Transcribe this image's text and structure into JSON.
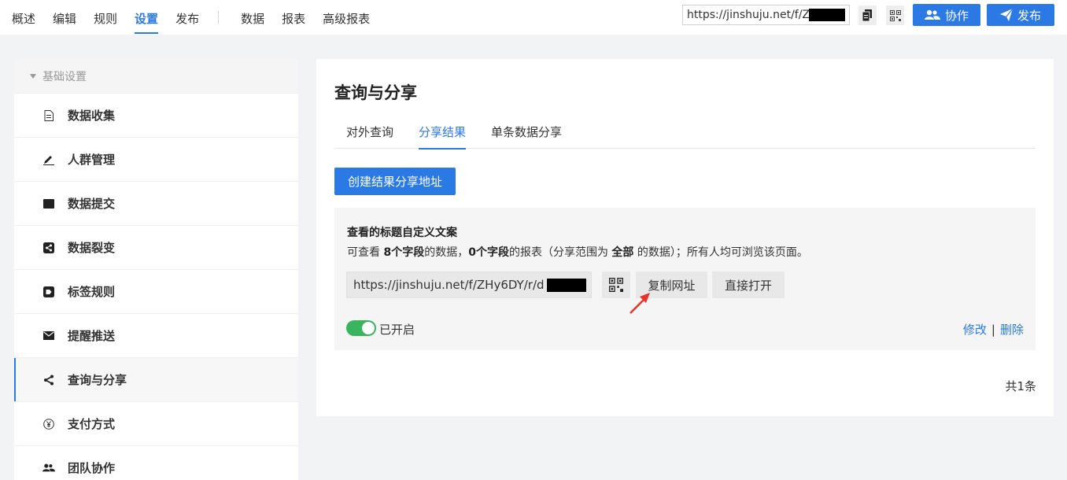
{
  "nav": {
    "items": [
      "概述",
      "编辑",
      "规则",
      "设置",
      "发布"
    ],
    "items2": [
      "数据",
      "报表",
      "高级报表"
    ],
    "active": "设置"
  },
  "header": {
    "url": "https://jinshuju.net/f/Z",
    "collab_label": "协作",
    "publish_label": "发布",
    "accent": "#2b79e4"
  },
  "sidebar": {
    "section": "基础设置",
    "items": [
      {
        "label": "数据收集",
        "icon": "document-icon"
      },
      {
        "label": "人群管理",
        "icon": "pen-icon"
      },
      {
        "label": "数据提交",
        "icon": "square-icon"
      },
      {
        "label": "数据裂变",
        "icon": "share-square-icon"
      },
      {
        "label": "标签规则",
        "icon": "tag-icon"
      },
      {
        "label": "提醒推送",
        "icon": "mail-icon"
      },
      {
        "label": "查询与分享",
        "icon": "share-icon"
      },
      {
        "label": "支付方式",
        "icon": "yen-icon"
      },
      {
        "label": "团队协作",
        "icon": "team-icon"
      }
    ],
    "active": "查询与分享"
  },
  "main": {
    "title": "查询与分享",
    "tabs": [
      "对外查询",
      "分享结果",
      "单条数据分享"
    ],
    "active_tab": "分享结果",
    "create_button": "创建结果分享地址",
    "panel": {
      "title": "查看的标题自定义文案",
      "desc": {
        "p1": "可查看 ",
        "b1": "8个字段",
        "p2": "的数据，",
        "b2": "0个字段",
        "p3": "的报表（分享范围为 ",
        "b3": "全部",
        "p4": " 的数据）；所有人均可浏览该页面。"
      },
      "url": "https://jinshuju.net/f/ZHy6DY/r/d",
      "copy_button": "复制网址",
      "open_button": "直接打开",
      "toggle_label": "已开启",
      "toggle_on": true,
      "edit_link": "修改",
      "delete_link": "删除"
    },
    "total": "共1条"
  }
}
